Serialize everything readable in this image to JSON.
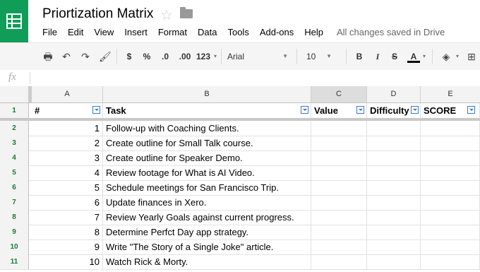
{
  "app": {
    "title": "Priortization Matrix",
    "status": "All changes saved in Drive"
  },
  "menu": [
    "File",
    "Edit",
    "View",
    "Insert",
    "Format",
    "Data",
    "Tools",
    "Add-ons",
    "Help"
  ],
  "toolbar": {
    "currency": "$",
    "percent": "%",
    "dec_less": ".0",
    "dec_more": ".00",
    "more_formats": "123",
    "font": "Arial",
    "font_size": "10",
    "bold": "B",
    "italic": "I",
    "strike": "S",
    "text_color": "A"
  },
  "formula_bar": {
    "label": "fx",
    "value": ""
  },
  "columns": [
    "A",
    "B",
    "C",
    "D",
    "E"
  ],
  "header_row": {
    "row_num": "1",
    "cells": [
      "#",
      "Task",
      "Value",
      "Difficulty",
      "SCORE"
    ]
  },
  "rows": [
    {
      "row_num": "2",
      "num": "1",
      "task": "Follow-up with Coaching Clients."
    },
    {
      "row_num": "3",
      "num": "2",
      "task": "Create outline for Small Talk course."
    },
    {
      "row_num": "4",
      "num": "3",
      "task": "Create outline for Speaker Demo."
    },
    {
      "row_num": "5",
      "num": "4",
      "task": "Review footage for What is AI Video."
    },
    {
      "row_num": "6",
      "num": "5",
      "task": "Schedule meetings for San Francisco Trip."
    },
    {
      "row_num": "7",
      "num": "6",
      "task": "Update finances in Xero."
    },
    {
      "row_num": "8",
      "num": "7",
      "task": "Review Yearly Goals against current progress."
    },
    {
      "row_num": "9",
      "num": "8",
      "task": "Determine Perfct Day app strategy."
    },
    {
      "row_num": "10",
      "num": "9",
      "task": "Write \"The Story of a Single Joke\" article."
    },
    {
      "row_num": "11",
      "num": "10",
      "task": "Watch Rick & Morty."
    }
  ],
  "colors": {
    "brand": "#0f9d58",
    "filter": "#3c78d8",
    "rownum": "#1a7a34"
  }
}
